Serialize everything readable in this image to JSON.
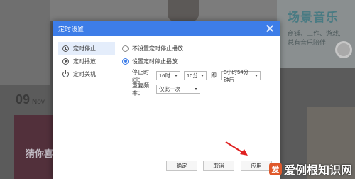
{
  "background": {
    "promo_title": "场景音乐",
    "promo_line1": "商铺、工作、游戏,",
    "promo_line2": "总有音乐陪伴",
    "date_day": "09",
    "date_month": "Nov",
    "card_text": "猜你喜"
  },
  "dialog": {
    "title": "定时设置",
    "nav": [
      {
        "label": "定时停止",
        "icon": "clock-icon"
      },
      {
        "label": "定时播放",
        "icon": "play-circle-icon"
      },
      {
        "label": "定时关机",
        "icon": "power-icon"
      }
    ],
    "option_no_stop": "不设置定时停止播放",
    "option_set_stop": "设置定时停止播放",
    "stop_time_label": "停止时间：",
    "hour_value": "16时",
    "minute_value": "10分",
    "at_label": "即",
    "countdown_value": "0小时54分钟后",
    "repeat_label": "重复频率：",
    "repeat_value": "仅此一次",
    "buttons": {
      "confirm": "确定",
      "cancel": "取消",
      "apply": "应用"
    }
  },
  "watermark": {
    "logo_char": "爱",
    "text": "爱例根知识网"
  },
  "colors": {
    "accent": "#3d7de8",
    "arrow": "#e02020"
  }
}
